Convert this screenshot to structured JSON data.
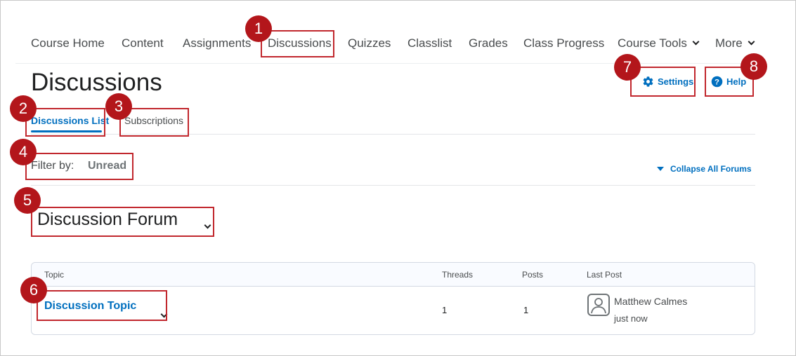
{
  "nav": {
    "course_home": "Course Home",
    "content": "Content",
    "assignments": "Assignments",
    "discussions": "Discussions",
    "quizzes": "Quizzes",
    "classlist": "Classlist",
    "grades": "Grades",
    "class_progress": "Class Progress",
    "course_tools": "Course Tools",
    "more": "More"
  },
  "page": {
    "title": "Discussions",
    "settings": "Settings",
    "help": "Help"
  },
  "tabs": {
    "list": "Discussions List",
    "subscriptions": "Subscriptions"
  },
  "filter": {
    "label": "Filter by:",
    "value": "Unread",
    "collapse": "Collapse All Forums"
  },
  "forum": {
    "title": "Discussion Forum"
  },
  "table": {
    "headers": {
      "topic": "Topic",
      "threads": "Threads",
      "posts": "Posts",
      "last_post": "Last Post"
    },
    "row": {
      "topic": "Discussion Topic",
      "threads": "1",
      "posts": "1",
      "author": "Matthew Calmes",
      "time": "just now"
    }
  },
  "badges": [
    "1",
    "2",
    "3",
    "4",
    "5",
    "6",
    "7",
    "8"
  ],
  "colors": {
    "accent": "#006fbf",
    "highlight": "#c1272d",
    "badge": "#b3161b"
  }
}
